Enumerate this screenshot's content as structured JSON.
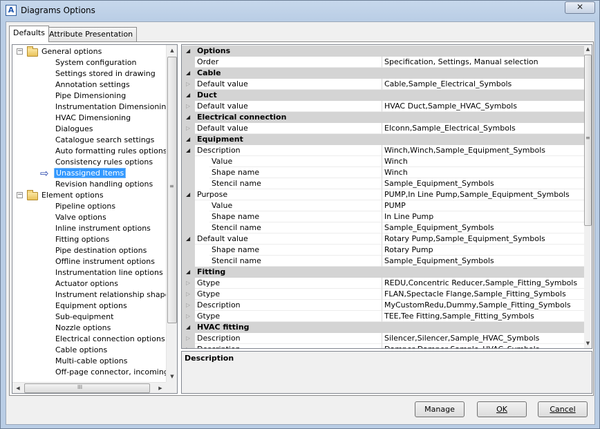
{
  "window": {
    "title": "Diagrams Options",
    "app_icon_glyph": "A",
    "close_glyph": "✕"
  },
  "tabs": [
    {
      "label": "Defaults",
      "active": true
    },
    {
      "label": "Attribute Presentation",
      "active": false
    }
  ],
  "tree": {
    "groups": [
      {
        "label": "General options",
        "expanded": true
      },
      {
        "label": "Element options",
        "expanded": true
      }
    ],
    "general_items": [
      "System configuration",
      "Settings stored in drawing",
      "Annotation settings",
      "Pipe Dimensioning",
      "Instrumentation Dimensioning",
      "HVAC Dimensioning",
      "Dialogues",
      "Catalogue search settings",
      "Auto formatting rules options",
      "Consistency rules options",
      "Unassigned Items",
      "Revision handling options"
    ],
    "element_items": [
      "Pipeline options",
      "Valve options",
      "Inline instrument options",
      "Fitting options",
      "Pipe destination options",
      "Offline instrument options",
      "Instrumentation line options",
      "Actuator options",
      "Instrument relationship shape opt",
      "Equipment options",
      "Sub-equipment",
      "Nozzle options",
      "Electrical connection options",
      "Cable options",
      "Multi-cable options",
      "Off-page connector, incoming op"
    ],
    "selected": "Unassigned Items"
  },
  "grid": {
    "rows": [
      {
        "type": "cat",
        "name": "Options"
      },
      {
        "type": "prop",
        "indent": 0,
        "name": "Order",
        "value": "Specification, Settings, Manual selection"
      },
      {
        "type": "cat",
        "name": "Cable"
      },
      {
        "type": "prop",
        "indent": 0,
        "exp": "closed",
        "name": "Default value",
        "value": "Cable,Sample_Electrical_Symbols"
      },
      {
        "type": "cat",
        "name": "Duct"
      },
      {
        "type": "prop",
        "indent": 0,
        "exp": "closed",
        "name": "Default value",
        "value": "HVAC Duct,Sample_HVAC_Symbols"
      },
      {
        "type": "cat",
        "name": "Electrical connection"
      },
      {
        "type": "prop",
        "indent": 0,
        "exp": "closed",
        "name": "Default value",
        "value": "Elconn,Sample_Electrical_Symbols"
      },
      {
        "type": "cat",
        "name": "Equipment"
      },
      {
        "type": "prop",
        "indent": 0,
        "exp": "open",
        "name": "Description",
        "value": "Winch,Winch,Sample_Equipment_Symbols"
      },
      {
        "type": "prop",
        "indent": 1,
        "name": "Value",
        "value": "Winch"
      },
      {
        "type": "prop",
        "indent": 1,
        "name": "Shape name",
        "value": "Winch"
      },
      {
        "type": "prop",
        "indent": 1,
        "name": "Stencil name",
        "value": "Sample_Equipment_Symbols"
      },
      {
        "type": "prop",
        "indent": 0,
        "exp": "open",
        "name": "Purpose",
        "value": "PUMP,In Line Pump,Sample_Equipment_Symbols"
      },
      {
        "type": "prop",
        "indent": 1,
        "name": "Value",
        "value": "PUMP"
      },
      {
        "type": "prop",
        "indent": 1,
        "name": "Shape name",
        "value": "In Line Pump"
      },
      {
        "type": "prop",
        "indent": 1,
        "name": "Stencil name",
        "value": "Sample_Equipment_Symbols"
      },
      {
        "type": "prop",
        "indent": 0,
        "exp": "open",
        "name": "Default value",
        "value": "Rotary Pump,Sample_Equipment_Symbols"
      },
      {
        "type": "prop",
        "indent": 1,
        "name": "Shape name",
        "value": "Rotary Pump"
      },
      {
        "type": "prop",
        "indent": 1,
        "name": "Stencil name",
        "value": "Sample_Equipment_Symbols"
      },
      {
        "type": "cat",
        "name": "Fitting"
      },
      {
        "type": "prop",
        "indent": 0,
        "exp": "closed",
        "name": "Gtype",
        "value": "REDU,Concentric Reducer,Sample_Fitting_Symbols"
      },
      {
        "type": "prop",
        "indent": 0,
        "exp": "closed",
        "name": "Gtype",
        "value": "FLAN,Spectacle Flange,Sample_Fitting_Symbols"
      },
      {
        "type": "prop",
        "indent": 0,
        "exp": "closed",
        "name": "Description",
        "value": "MyCustomRedu,Dummy,Sample_Fitting_Symbols"
      },
      {
        "type": "prop",
        "indent": 0,
        "exp": "closed",
        "name": "Gtype",
        "value": "TEE,Tee Fitting,Sample_Fitting_Symbols"
      },
      {
        "type": "cat",
        "name": "HVAC fitting"
      },
      {
        "type": "prop",
        "indent": 0,
        "exp": "closed",
        "name": "Description",
        "value": "Silencer,Silencer,Sample_HVAC_Symbols"
      },
      {
        "type": "prop",
        "indent": 0,
        "exp": "closed",
        "name": "Description",
        "value": "Damper,Damper,Sample_HVAC_Symbols"
      }
    ]
  },
  "description_panel": {
    "title": "Description"
  },
  "buttons": {
    "manage": "Manage",
    "ok": "OK",
    "cancel": "Cancel"
  },
  "scroll": {
    "tree_grip": "≡",
    "hgrip": "III",
    "grid_grip": "≡"
  },
  "colors": {
    "selection": "#3399ff",
    "category_band": "#d4d4d4",
    "title_bar": "#b9cde5"
  }
}
